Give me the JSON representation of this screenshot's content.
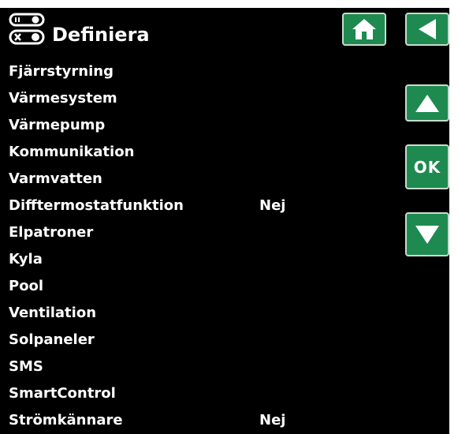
{
  "header": {
    "title": "Definiera",
    "icon": "settings-toggles-icon",
    "home_icon": "home-icon",
    "back_icon": "back-arrow-icon"
  },
  "side_buttons": {
    "up_icon": "arrow-up-icon",
    "ok_label": "OK",
    "down_icon": "arrow-down-icon"
  },
  "menu": {
    "items": [
      {
        "label": "Fjärrstyrning",
        "value": ""
      },
      {
        "label": "Värmesystem",
        "value": ""
      },
      {
        "label": "Värmepump",
        "value": ""
      },
      {
        "label": "Kommunikation",
        "value": ""
      },
      {
        "label": "Varmvatten",
        "value": ""
      },
      {
        "label": "Difftermostatfunktion",
        "value": "Nej"
      },
      {
        "label": "Elpatroner",
        "value": ""
      },
      {
        "label": "Kyla",
        "value": ""
      },
      {
        "label": "Pool",
        "value": ""
      },
      {
        "label": "Ventilation",
        "value": ""
      },
      {
        "label": "Solpaneler",
        "value": ""
      },
      {
        "label": "SMS",
        "value": ""
      },
      {
        "label": "SmartControl",
        "value": ""
      },
      {
        "label": "Strömkännare",
        "value": "Nej"
      }
    ]
  },
  "colors": {
    "background": "#000000",
    "button": "#1e8a4f",
    "text": "#ffffff"
  }
}
